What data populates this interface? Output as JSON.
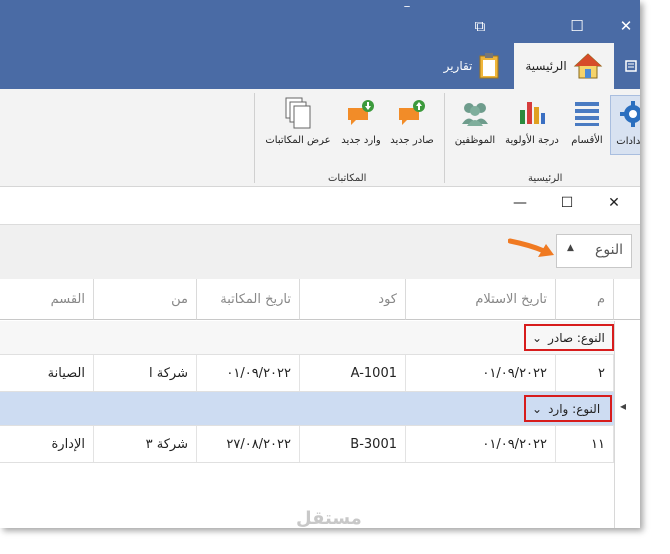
{
  "window": {
    "settings_marker": "ــ",
    "restore_glyph": "⧉",
    "maximize_glyph": "☐",
    "close_glyph": "✕"
  },
  "tabs": [
    {
      "label": "الرئيسية",
      "icon": "home-icon",
      "active": true
    },
    {
      "label": "تقارير",
      "icon": "clipboard-icon",
      "active": false
    }
  ],
  "ribbon": {
    "main_group_label": "الرئيسية",
    "mail_group_label": "المكاتبات",
    "buttons": [
      {
        "label": "إعدادات",
        "icon": "gear-icon"
      },
      {
        "label": "الأقسام",
        "icon": "list-icon"
      },
      {
        "label": "درجة الأولوية",
        "icon": "bar-chart-icon"
      },
      {
        "label": "الموظفين",
        "icon": "people-icon"
      },
      {
        "label": "صادر جديد",
        "icon": "chat-up-icon"
      },
      {
        "label": "وارد جديد",
        "icon": "chat-down-icon"
      },
      {
        "label": "عرض المكاتبات",
        "icon": "copy-icon"
      }
    ]
  },
  "grouping": {
    "chip_label": "النوع",
    "chip_arrow": "▲"
  },
  "columns": [
    "م",
    "تاريخ الاستلام",
    "كود",
    "تاريخ المكاتبة",
    "من",
    "القسم"
  ],
  "groups": [
    {
      "label": "النوع: صادر",
      "row": {
        "num": "٢",
        "received_date": "٠١/٠٩/٢٠٢٢",
        "code": "A-1001",
        "letter_date": "٠١/٠٩/٢٠٢٢",
        "from": "شركة ا",
        "department": "الصيانة"
      }
    },
    {
      "label": "النوع: وارد",
      "row": {
        "num": "١١",
        "received_date": "٠١/٠٩/٢٠٢٢",
        "code": "B-3001",
        "letter_date": "٢٧/٠٨/٢٠٢٢",
        "from": "شركة ٣",
        "department": "الإدارة"
      }
    }
  ],
  "row_indicator": "◂",
  "expand_glyph": "⌄",
  "watermark": "مستقل",
  "colors": {
    "title_bar": "#4a6ba5",
    "selected_group_row": "#cddcf2",
    "highlight_border": "#d71c1c",
    "arrow": "#f07a22"
  }
}
